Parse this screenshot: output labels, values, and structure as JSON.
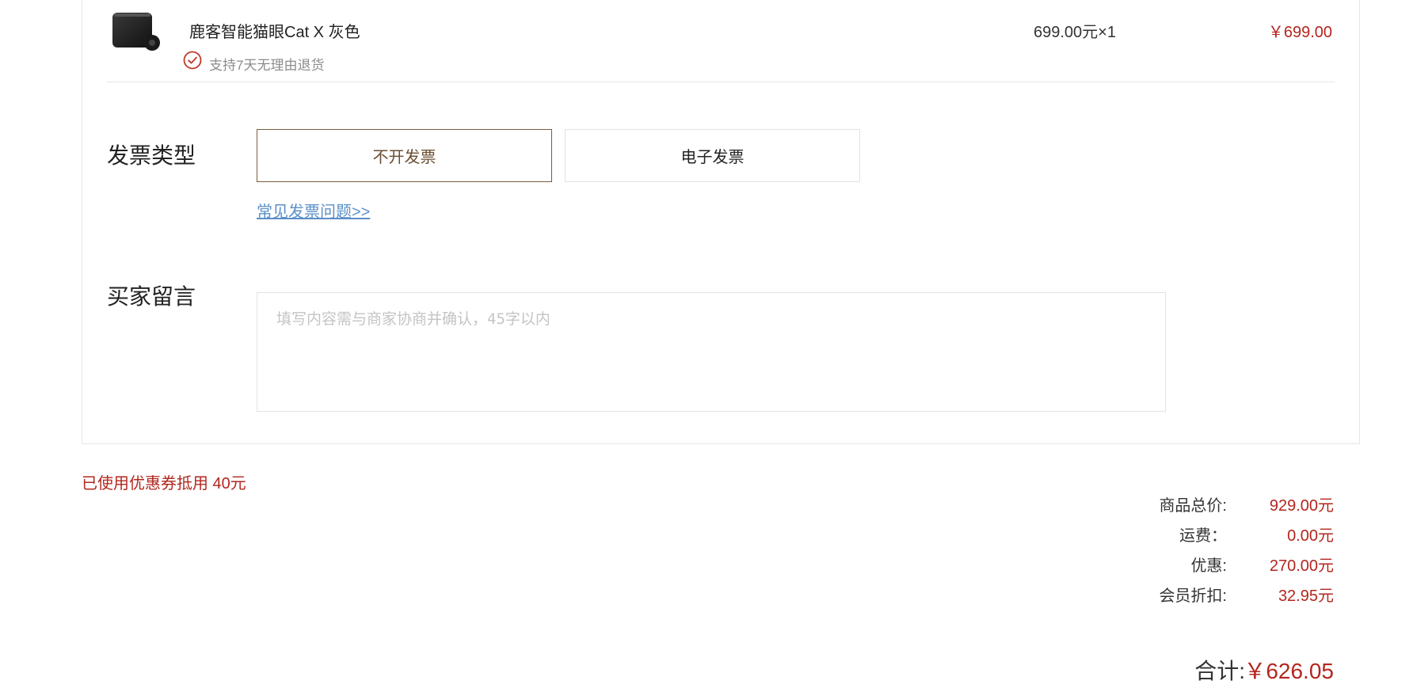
{
  "product": {
    "name": "鹿客智能猫眼Cat X 灰色",
    "return_policy": "支持7天无理由退货",
    "unit_price_qty": "699.00元×1",
    "line_total": "￥699.00"
  },
  "invoice": {
    "label": "发票类型",
    "options": [
      {
        "label": "不开发票",
        "selected": true
      },
      {
        "label": "电子发票",
        "selected": false
      }
    ],
    "faq_link": "常见发票问题>>"
  },
  "message": {
    "label": "买家留言",
    "placeholder": "填写内容需与商家协商并确认，45字以内"
  },
  "coupon_note": "已使用优惠券抵用 40元",
  "summary": [
    {
      "label": "商品总价:",
      "value": "929.00元"
    },
    {
      "label": "运费：",
      "value": "0.00元"
    },
    {
      "label": "优惠:",
      "value": "270.00元"
    },
    {
      "label": "会员折扣:",
      "value": "32.95元"
    }
  ],
  "total": {
    "label": "合计:",
    "value": "￥626.05"
  },
  "colors": {
    "accent_red": "#b3261e",
    "selected_border": "#7a5c3e",
    "link_blue": "#5b8fc7"
  },
  "icons": {
    "return_check": "check-circle-icon",
    "product_image": "smart-peephole-camera-image"
  }
}
